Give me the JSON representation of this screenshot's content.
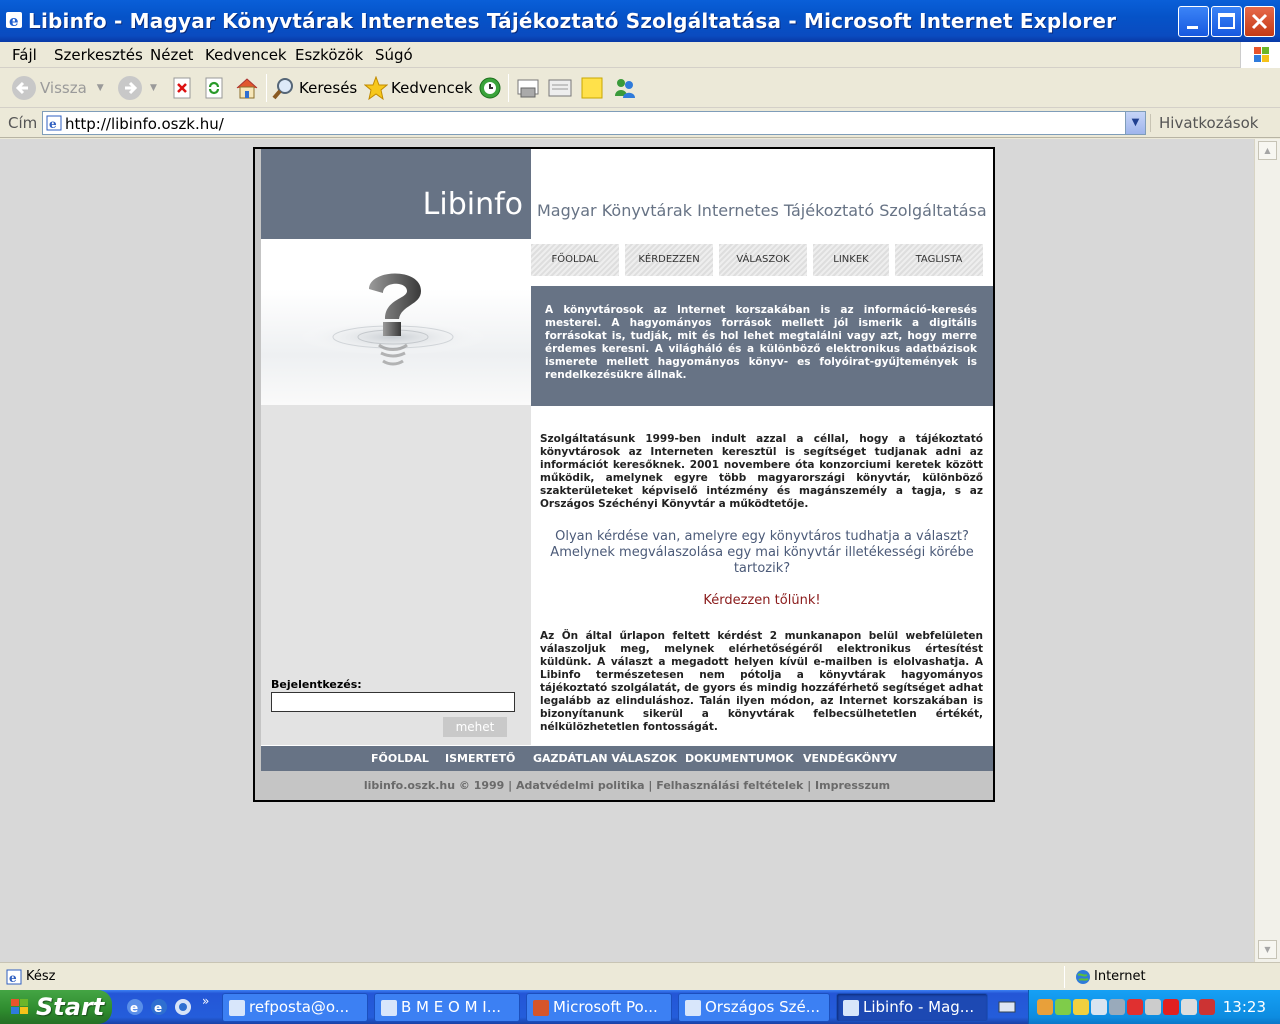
{
  "window": {
    "title": "Libinfo - Magyar Könyvtárak Internetes Tájékoztató Szolgáltatása - Microsoft Internet Explorer"
  },
  "menu": [
    "Fájl",
    "Szerkesztés",
    "Nézet",
    "Kedvencek",
    "Eszközök",
    "Súgó"
  ],
  "toolbar": {
    "back_label": "Vissza",
    "search_label": "Keresés",
    "favorites_label": "Kedvencek"
  },
  "address": {
    "label": "Cím",
    "url": "http://libinfo.oszk.hu/",
    "links_label": "Hivatkozások"
  },
  "site": {
    "brand": "Libinfo",
    "tagline": "Magyar Könyvtárak Internetes Tájékoztató Szolgáltatása",
    "nav": [
      "FŐOLDAL",
      "KÉRDEZZEN",
      "VÁLASZOK",
      "LINKEK",
      "TAGLISTA"
    ],
    "intro": "A könyvtárosok az Internet korszakában is az információ-keresés mesterei. A hagyományos források mellett jól ismerik a digitális forrásokat is, tudják, mit és hol lehet megtalálni vagy azt, hogy merre érdemes keresni. A világháló és a különböző elektronikus adatbázisok ismerete mellett hagyományos könyv- es folyóirat-gyűjtemények is rendelkezésükre állnak.",
    "paragraph1": "Szolgáltatásunk 1999-ben indult azzal a céllal, hogy a tájékoztató könyvtárosok az Interneten keresztül is segítséget tudjanak adni az információt keresőknek. 2001 novembere óta konzorciumi keretek között működik, amelynek egyre több magyarországi könyvtár, különböző szakterületeket képviselő intézmény és magánszemély a tagja, s az Országos Széchényi Könyvtár a működtetője.",
    "question": "Olyan kérdése van, amelyre egy könyvtáros tudhatja a választ? Amelynek megválaszolása egy mai könyvtár illetékességi körébe tartozik?",
    "ask_link": "Kérdezzen tőlünk!",
    "paragraph2": "Az Ön által űrlapon feltett kérdést 2 munkanapon belül webfelületen válaszoljuk meg, melynek elérhetőségéről elektronikus értesítést küldünk. A választ a megadott helyen kívül e-mailben is elolvashatja. A Libinfo természetesen nem pótolja a könyvtárak hagyományos tájékoztató szolgálatát, de gyors és mindig hozzáférhető segítséget adhat legalább az elinduláshoz. Talán ilyen módon, az Internet korszakában is bizonyítanunk sikerül a könyvtárak felbecsülhetetlen értékét, nélkülözhetetlen fontosságát.",
    "login_label": "Bejelentkezés:",
    "go_button": "mehet",
    "footer_nav": [
      "FŐOLDAL",
      "ISMERTETŐ",
      "GAZDÁTLAN VÁLASZOK",
      "DOKUMENTUMOK",
      "VENDÉGKÖNYV"
    ],
    "footer_copy": "libinfo.oszk.hu © 1999 | Adatvédelmi politika | Felhasználási feltételek | Impresszum"
  },
  "status": {
    "text": "Kész",
    "zone": "Internet"
  },
  "taskbar": {
    "start": "Start",
    "tasks": [
      "refposta@o...",
      "B M E  O M I...",
      "Microsoft Po...",
      "Országos Szé...",
      "Libinfo - Mag..."
    ],
    "clock": "13:23"
  }
}
